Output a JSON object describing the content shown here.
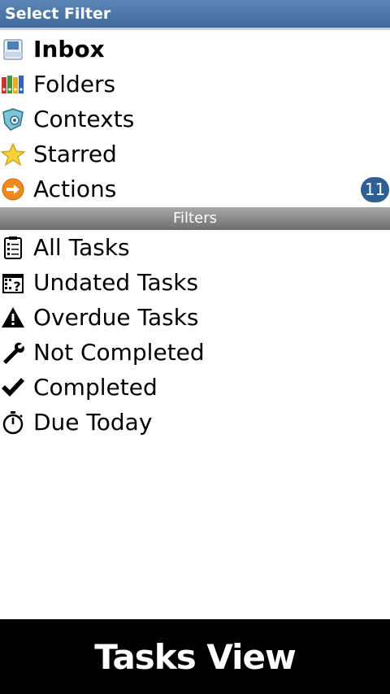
{
  "header": {
    "title": "Select Filter"
  },
  "main_items": [
    {
      "label": "Inbox",
      "icon": "inbox-icon"
    },
    {
      "label": "Folders",
      "icon": "folders-icon"
    },
    {
      "label": "Contexts",
      "icon": "contexts-icon"
    },
    {
      "label": "Starred",
      "icon": "star-icon"
    },
    {
      "label": "Actions",
      "icon": "arrow-right-icon",
      "badge": "11"
    }
  ],
  "filters_header": "Filters",
  "filters": [
    {
      "label": "All Tasks",
      "icon": "clipboard-icon"
    },
    {
      "label": "Undated Tasks",
      "icon": "calendar-question-icon"
    },
    {
      "label": "Overdue Tasks",
      "icon": "warning-icon"
    },
    {
      "label": "Not Completed",
      "icon": "wrench-icon"
    },
    {
      "label": "Completed",
      "icon": "checkmark-icon"
    },
    {
      "label": "Due Today",
      "icon": "stopwatch-icon"
    }
  ],
  "footer": {
    "label": "Tasks View"
  },
  "colors": {
    "title_bar": "#4a75a7",
    "badge": "#2e5f93",
    "filters_bar": "#8a8a8a"
  }
}
